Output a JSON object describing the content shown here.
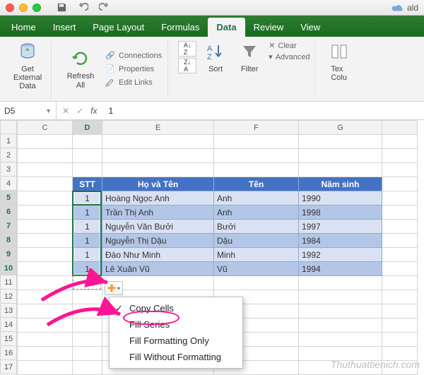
{
  "titlebar": {
    "doc_hint": "ald"
  },
  "tabs": {
    "home": "Home",
    "insert": "Insert",
    "page_layout": "Page Layout",
    "formulas": "Formulas",
    "data": "Data",
    "review": "Review",
    "view": "View"
  },
  "ribbon": {
    "get_external": "Get External\nData",
    "refresh_all": "Refresh\nAll",
    "connections": "Connections",
    "properties": "Properties",
    "edit_links": "Edit Links",
    "sort": "Sort",
    "filter": "Filter",
    "clear": "Clear",
    "advanced": "Advanced",
    "text_to_cols": "Tex\nColu"
  },
  "namebox": "D5",
  "formula_value": "1",
  "col_headers": [
    "C",
    "D",
    "E",
    "F",
    "G"
  ],
  "row_headers": [
    "1",
    "2",
    "3",
    "4",
    "5",
    "6",
    "7",
    "8",
    "9",
    "10",
    "11",
    "12",
    "13",
    "14",
    "15",
    "16",
    "17"
  ],
  "table": {
    "headers": {
      "stt": "STT",
      "hoten": "Họ và Tên",
      "ten": "Tên",
      "namsinh": "Năm sinh"
    },
    "rows": [
      {
        "stt": "1",
        "hoten": "Hoàng Ngọc Anh",
        "ten": "Anh",
        "namsinh": "1990"
      },
      {
        "stt": "1",
        "hoten": "Trần Thị Anh",
        "ten": "Anh",
        "namsinh": "1998"
      },
      {
        "stt": "1",
        "hoten": "Nguyễn Văn Bưởi",
        "ten": "Bưởi",
        "namsinh": "1997"
      },
      {
        "stt": "1",
        "hoten": "Nguyễn Thị Dậu",
        "ten": "Dậu",
        "namsinh": "1984"
      },
      {
        "stt": "1",
        "hoten": "Đào Như Minh",
        "ten": "Minh",
        "namsinh": "1992"
      },
      {
        "stt": "1",
        "hoten": "Lê Xuân Vũ",
        "ten": "Vũ",
        "namsinh": "1994"
      }
    ]
  },
  "autofill_menu": {
    "copy_cells": "Copy Cells",
    "fill_series": "Fill Series",
    "fill_formatting_only": "Fill Formatting Only",
    "fill_without_formatting": "Fill Without Formatting"
  },
  "watermark": "Thuthuattienich.com",
  "fx_label": "fx"
}
